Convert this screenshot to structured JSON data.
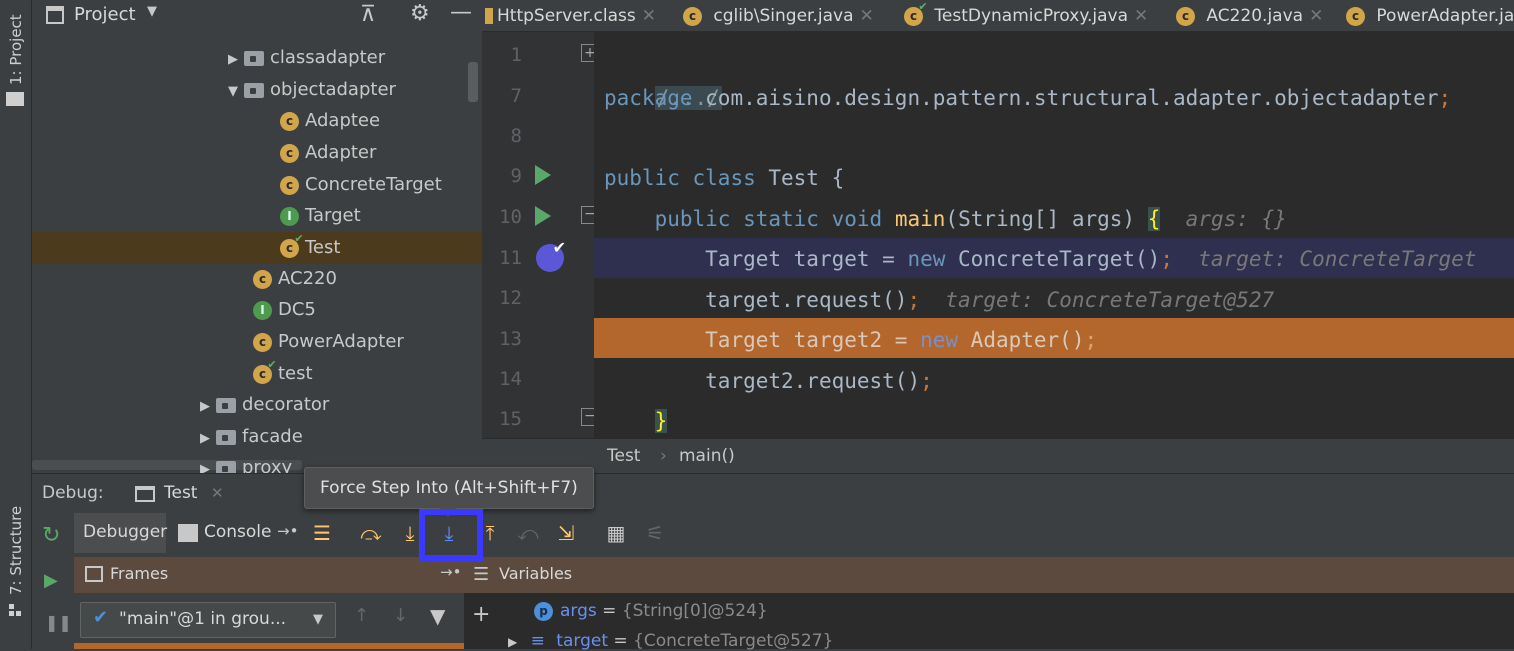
{
  "left_bar": {
    "project_tab": "1: Project",
    "structure_tab": "7: Structure"
  },
  "project": {
    "title": "Project",
    "tree": [
      {
        "label": "classadapter",
        "kind": "folder",
        "expand": "▶",
        "indent": 1
      },
      {
        "label": "objectadapter",
        "kind": "folder",
        "expand": "▼",
        "indent": 1
      },
      {
        "label": "Adaptee",
        "kind": "class",
        "indent": 2
      },
      {
        "label": "Adapter",
        "kind": "class",
        "indent": 2
      },
      {
        "label": "ConcreteTarget",
        "kind": "class",
        "indent": 2
      },
      {
        "label": "Target",
        "kind": "interface",
        "indent": 2
      },
      {
        "label": "Test",
        "kind": "runclass",
        "indent": 2,
        "selected": true
      },
      {
        "label": "AC220",
        "kind": "class",
        "indent": 1
      },
      {
        "label": "DC5",
        "kind": "interface",
        "indent": 1
      },
      {
        "label": "PowerAdapter",
        "kind": "class",
        "indent": 1
      },
      {
        "label": "test",
        "kind": "runclass",
        "indent": 1
      },
      {
        "label": "decorator",
        "kind": "folder",
        "expand": "▶",
        "indent": 0
      },
      {
        "label": "facade",
        "kind": "folder",
        "expand": "▶",
        "indent": 0
      },
      {
        "label": "proxy",
        "kind": "folder",
        "expand": "▶",
        "indent": 0
      }
    ]
  },
  "tabs": [
    {
      "label": "HttpServer.class"
    },
    {
      "label": "cglib\\Singer.java"
    },
    {
      "label": "TestDynamicProxy.java"
    },
    {
      "label": "AC220.java"
    },
    {
      "label": "PowerAdapter.ja"
    }
  ],
  "editor": {
    "line_numbers": [
      "1",
      "7",
      "8",
      "9",
      "10",
      "11",
      "12",
      "13",
      "14",
      "15"
    ],
    "fold_text": "/.../",
    "l7_kw": "package",
    "l7_rest": " com.aisino.design.pattern.structural.adapter.objectadapter",
    "semicolon": ";",
    "l9_kw1": "public",
    "l9_kw2": "class",
    "l9_rest": " Test {",
    "l10_kw1": "public",
    "l10_kw2": "static",
    "l10_kw3": "void",
    "l10_fn": "main",
    "l10_rest": "(String[] args) ",
    "l10_brace": "{",
    "l10_hint": "args: {}",
    "l11_a": "Target target = ",
    "l11_new": "new",
    "l11_b": " ConcreteTarget()",
    "l11_hint": "target: ConcreteTarget",
    "l12_a": "target.request()",
    "l12_hint": "target: ConcreteTarget@527",
    "l13_a": "Target target2 = ",
    "l13_new": "new",
    "l13_b": " Adapter()",
    "l14_a": "target2.request()",
    "l15_brace": "}"
  },
  "breadcrumb": {
    "class": "Test",
    "sep": "›",
    "method": "main()"
  },
  "debug": {
    "label": "Debug:",
    "session": "Test",
    "debugger_tab": "Debugger",
    "console_tab": "Console",
    "tooltip": "Force Step Into (Alt+Shift+F7)",
    "frames_label": "Frames",
    "variables_label": "Variables",
    "thread": "\"main\"@1 in grou...",
    "vars": [
      {
        "name": "args",
        "value": "{String[0]@524}"
      },
      {
        "name": "target",
        "value": "{ConcreteTarget@527}"
      }
    ]
  },
  "colors": {
    "highlight": "#3b38ff",
    "execution_line": "#b4672c",
    "selected_tree": "#4c3a1c"
  }
}
